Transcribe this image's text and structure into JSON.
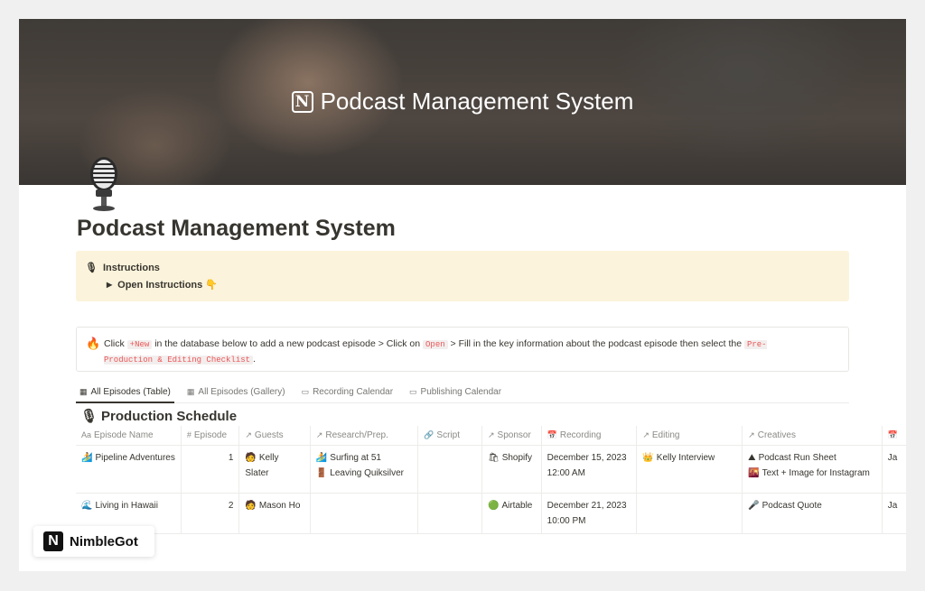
{
  "cover": {
    "title": "Podcast Management System"
  },
  "page": {
    "title": "Podcast Management System"
  },
  "callout": {
    "heading": "Instructions",
    "toggle_label": "Open Instructions 👇"
  },
  "note": {
    "t1": "Click ",
    "code1": "+New",
    "t2": " in the database below to add a new podcast episode > Click on ",
    "code2": "Open",
    "t3": " > Fill in the key information about the podcast episode then select the ",
    "code3": "Pre-Production & Editing Checklist",
    "t4": "."
  },
  "tabs": [
    {
      "label": "All Episodes (Table)",
      "icon": "table-icon"
    },
    {
      "label": "All Episodes (Gallery)",
      "icon": "gallery-icon"
    },
    {
      "label": "Recording Calendar",
      "icon": "calendar-icon"
    },
    {
      "label": "Publishing Calendar",
      "icon": "calendar-icon"
    }
  ],
  "database": {
    "title": "Production Schedule",
    "columns": [
      {
        "label": "Episode Name",
        "icon": "Aa"
      },
      {
        "label": "Episode",
        "icon": "#"
      },
      {
        "label": "Guests",
        "icon": "↗"
      },
      {
        "label": "Research/Prep.",
        "icon": "↗"
      },
      {
        "label": "Script",
        "icon": "🔗"
      },
      {
        "label": "Sponsor",
        "icon": "↗"
      },
      {
        "label": "Recording",
        "icon": "📅"
      },
      {
        "label": "Editing",
        "icon": "↗"
      },
      {
        "label": "Creatives",
        "icon": "↗"
      },
      {
        "label": "",
        "icon": "📅"
      }
    ],
    "rows": [
      {
        "name_emoji": "🏄",
        "name": "Pipeline Adventures",
        "episode": "1",
        "guest_emoji": "🧑",
        "guest": "Kelly Slater",
        "research": [
          {
            "emoji": "🏄",
            "label": "Surfing at 51"
          },
          {
            "emoji": "🚪",
            "label": "Leaving Quiksilver"
          }
        ],
        "script": "",
        "sponsor_emoji": "🛍",
        "sponsor": "Shopify",
        "recording_date": "December 15, 2023",
        "recording_time": "12:00 AM",
        "editing_emoji": "👑",
        "editing": "Kelly Interview",
        "creatives": [
          {
            "emoji": "⛰",
            "label": "Podcast Run Sheet"
          },
          {
            "emoji": "🌇",
            "label": "Text + Image for Instagram"
          }
        ],
        "extra": "Ja"
      },
      {
        "name_emoji": "🌊",
        "name": "Living in Hawaii",
        "episode": "2",
        "guest_emoji": "🧑",
        "guest": "Mason Ho",
        "research": [],
        "script": "",
        "sponsor_emoji": "🟢",
        "sponsor": "Airtable",
        "recording_date": "December 21, 2023",
        "recording_time": "10:00 PM",
        "editing_emoji": "",
        "editing": "",
        "creatives": [
          {
            "emoji": "🎤",
            "label": "Podcast Quote"
          }
        ],
        "extra": "Ja"
      }
    ]
  },
  "watermark": {
    "letter": "N",
    "label": "NimbleGot"
  }
}
